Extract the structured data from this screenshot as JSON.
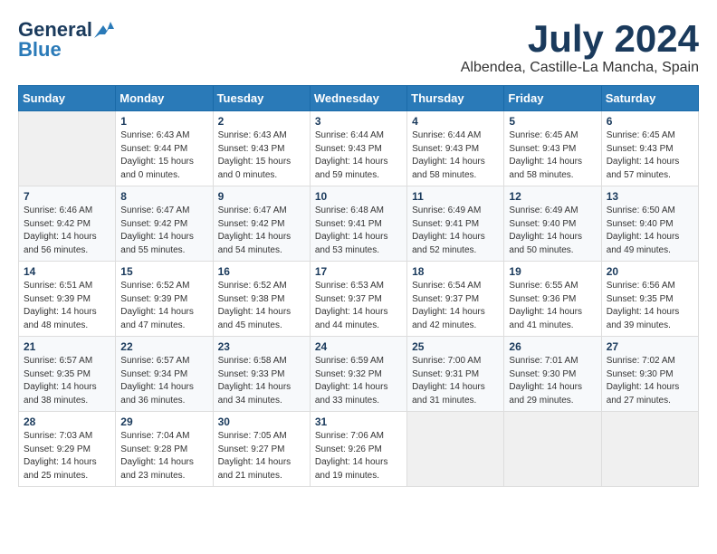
{
  "logo": {
    "line1": "General",
    "line2": "Blue"
  },
  "title": {
    "month": "July 2024",
    "location": "Albendea, Castille-La Mancha, Spain"
  },
  "weekdays": [
    "Sunday",
    "Monday",
    "Tuesday",
    "Wednesday",
    "Thursday",
    "Friday",
    "Saturday"
  ],
  "weeks": [
    [
      {
        "day": "",
        "info": ""
      },
      {
        "day": "1",
        "info": "Sunrise: 6:43 AM\nSunset: 9:44 PM\nDaylight: 15 hours\nand 0 minutes."
      },
      {
        "day": "2",
        "info": "Sunrise: 6:43 AM\nSunset: 9:43 PM\nDaylight: 15 hours\nand 0 minutes."
      },
      {
        "day": "3",
        "info": "Sunrise: 6:44 AM\nSunset: 9:43 PM\nDaylight: 14 hours\nand 59 minutes."
      },
      {
        "day": "4",
        "info": "Sunrise: 6:44 AM\nSunset: 9:43 PM\nDaylight: 14 hours\nand 58 minutes."
      },
      {
        "day": "5",
        "info": "Sunrise: 6:45 AM\nSunset: 9:43 PM\nDaylight: 14 hours\nand 58 minutes."
      },
      {
        "day": "6",
        "info": "Sunrise: 6:45 AM\nSunset: 9:43 PM\nDaylight: 14 hours\nand 57 minutes."
      }
    ],
    [
      {
        "day": "7",
        "info": "Sunrise: 6:46 AM\nSunset: 9:42 PM\nDaylight: 14 hours\nand 56 minutes."
      },
      {
        "day": "8",
        "info": "Sunrise: 6:47 AM\nSunset: 9:42 PM\nDaylight: 14 hours\nand 55 minutes."
      },
      {
        "day": "9",
        "info": "Sunrise: 6:47 AM\nSunset: 9:42 PM\nDaylight: 14 hours\nand 54 minutes."
      },
      {
        "day": "10",
        "info": "Sunrise: 6:48 AM\nSunset: 9:41 PM\nDaylight: 14 hours\nand 53 minutes."
      },
      {
        "day": "11",
        "info": "Sunrise: 6:49 AM\nSunset: 9:41 PM\nDaylight: 14 hours\nand 52 minutes."
      },
      {
        "day": "12",
        "info": "Sunrise: 6:49 AM\nSunset: 9:40 PM\nDaylight: 14 hours\nand 50 minutes."
      },
      {
        "day": "13",
        "info": "Sunrise: 6:50 AM\nSunset: 9:40 PM\nDaylight: 14 hours\nand 49 minutes."
      }
    ],
    [
      {
        "day": "14",
        "info": "Sunrise: 6:51 AM\nSunset: 9:39 PM\nDaylight: 14 hours\nand 48 minutes."
      },
      {
        "day": "15",
        "info": "Sunrise: 6:52 AM\nSunset: 9:39 PM\nDaylight: 14 hours\nand 47 minutes."
      },
      {
        "day": "16",
        "info": "Sunrise: 6:52 AM\nSunset: 9:38 PM\nDaylight: 14 hours\nand 45 minutes."
      },
      {
        "day": "17",
        "info": "Sunrise: 6:53 AM\nSunset: 9:37 PM\nDaylight: 14 hours\nand 44 minutes."
      },
      {
        "day": "18",
        "info": "Sunrise: 6:54 AM\nSunset: 9:37 PM\nDaylight: 14 hours\nand 42 minutes."
      },
      {
        "day": "19",
        "info": "Sunrise: 6:55 AM\nSunset: 9:36 PM\nDaylight: 14 hours\nand 41 minutes."
      },
      {
        "day": "20",
        "info": "Sunrise: 6:56 AM\nSunset: 9:35 PM\nDaylight: 14 hours\nand 39 minutes."
      }
    ],
    [
      {
        "day": "21",
        "info": "Sunrise: 6:57 AM\nSunset: 9:35 PM\nDaylight: 14 hours\nand 38 minutes."
      },
      {
        "day": "22",
        "info": "Sunrise: 6:57 AM\nSunset: 9:34 PM\nDaylight: 14 hours\nand 36 minutes."
      },
      {
        "day": "23",
        "info": "Sunrise: 6:58 AM\nSunset: 9:33 PM\nDaylight: 14 hours\nand 34 minutes."
      },
      {
        "day": "24",
        "info": "Sunrise: 6:59 AM\nSunset: 9:32 PM\nDaylight: 14 hours\nand 33 minutes."
      },
      {
        "day": "25",
        "info": "Sunrise: 7:00 AM\nSunset: 9:31 PM\nDaylight: 14 hours\nand 31 minutes."
      },
      {
        "day": "26",
        "info": "Sunrise: 7:01 AM\nSunset: 9:30 PM\nDaylight: 14 hours\nand 29 minutes."
      },
      {
        "day": "27",
        "info": "Sunrise: 7:02 AM\nSunset: 9:30 PM\nDaylight: 14 hours\nand 27 minutes."
      }
    ],
    [
      {
        "day": "28",
        "info": "Sunrise: 7:03 AM\nSunset: 9:29 PM\nDaylight: 14 hours\nand 25 minutes."
      },
      {
        "day": "29",
        "info": "Sunrise: 7:04 AM\nSunset: 9:28 PM\nDaylight: 14 hours\nand 23 minutes."
      },
      {
        "day": "30",
        "info": "Sunrise: 7:05 AM\nSunset: 9:27 PM\nDaylight: 14 hours\nand 21 minutes."
      },
      {
        "day": "31",
        "info": "Sunrise: 7:06 AM\nSunset: 9:26 PM\nDaylight: 14 hours\nand 19 minutes."
      },
      {
        "day": "",
        "info": ""
      },
      {
        "day": "",
        "info": ""
      },
      {
        "day": "",
        "info": ""
      }
    ]
  ]
}
